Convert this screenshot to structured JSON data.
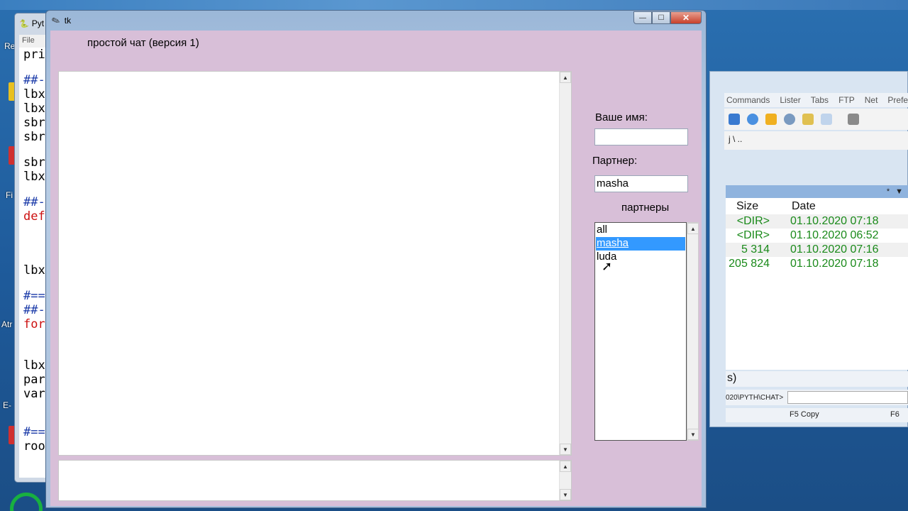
{
  "desktop": {
    "labels": [
      "Re",
      "Fi",
      "Atr",
      "E-"
    ],
    "icon_colors": [
      "#e8c020",
      "#d03030",
      "#3a9a3a",
      "#d8d8d8"
    ]
  },
  "python_window": {
    "title": "Pyt",
    "menu_file": "File",
    "code_lines": [
      {
        "text": "pri",
        "color": "#000000"
      },
      {
        "text": "##-",
        "color": "#1a3aa8"
      },
      {
        "text": "lbx",
        "color": "#000000"
      },
      {
        "text": "lbx",
        "color": "#000000"
      },
      {
        "text": "sbr",
        "color": "#000000"
      },
      {
        "text": "sbr",
        "color": "#000000"
      },
      {
        "text": "sbr",
        "color": "#000000"
      },
      {
        "text": "lbx",
        "color": "#000000"
      },
      {
        "text": "##-",
        "color": "#1a3aa8"
      },
      {
        "text": "def",
        "color": "#cc1010"
      },
      {
        "text": "lbx",
        "color": "#000000"
      },
      {
        "text": "#==",
        "color": "#1a3aa8"
      },
      {
        "text": "##-",
        "color": "#1a3aa8"
      },
      {
        "text": "for",
        "color": "#cc1010"
      },
      {
        "text": "lbx",
        "color": "#000000"
      },
      {
        "text": "par",
        "color": "#000000"
      },
      {
        "text": "var",
        "color": "#000000"
      },
      {
        "text": "#==",
        "color": "#1a3aa8"
      },
      {
        "text": "roo",
        "color": "#000000"
      }
    ]
  },
  "file_manager": {
    "menu": [
      "Commands",
      "Lister",
      "Tabs",
      "FTP",
      "Net",
      "Prefere"
    ],
    "drive_bar": "j   \\   ..",
    "pathbar_star": "*",
    "columns": {
      "size": "Size",
      "date": "Date"
    },
    "rows": [
      {
        "size": "<DIR>",
        "date": "01.10.2020 07:18"
      },
      {
        "size": "<DIR>",
        "date": "01.10.2020 06:52"
      },
      {
        "size": "5 314",
        "date": "01.10.2020 07:16"
      },
      {
        "size": "205 824",
        "date": "01.10.2020 07:18"
      }
    ],
    "status": "s)",
    "cmd_path": "020\\PYTH\\CHAT>",
    "fkey_copy": "F5 Copy",
    "fkey_next": "F6"
  },
  "tk_window": {
    "title": "tk",
    "buttons": {
      "minimize": "—",
      "maximize": "☐",
      "close": "✕"
    },
    "app_heading": "простой чат (версия 1)",
    "your_name_label": "Ваше имя:",
    "your_name_value": "",
    "partner_label": "Партнер:",
    "partner_value": "masha",
    "partners_list_label": "партнеры",
    "partners": [
      "all",
      "masha",
      "luda"
    ],
    "selected_partner": "masha",
    "chat_text": "",
    "message_text": "",
    "colors": {
      "client_bg": "#d8bfd8",
      "selection": "#3399ff"
    }
  }
}
